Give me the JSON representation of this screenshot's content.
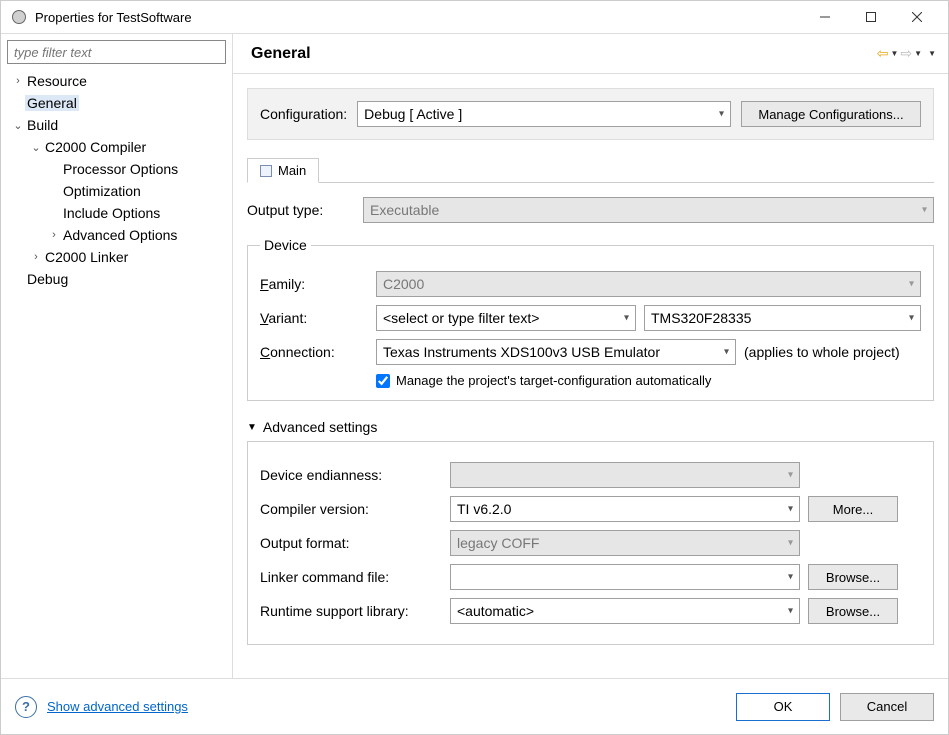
{
  "titlebar": {
    "title": "Properties for TestSoftware"
  },
  "sidebar": {
    "filter_placeholder": "type filter text",
    "items": [
      {
        "label": "Resource",
        "depth": 0,
        "twisty": "›"
      },
      {
        "label": "General",
        "depth": 0,
        "twisty": "",
        "selected": true
      },
      {
        "label": "Build",
        "depth": 0,
        "twisty": "⌄"
      },
      {
        "label": "C2000 Compiler",
        "depth": 1,
        "twisty": "⌄"
      },
      {
        "label": "Processor Options",
        "depth": 2,
        "twisty": ""
      },
      {
        "label": "Optimization",
        "depth": 2,
        "twisty": ""
      },
      {
        "label": "Include Options",
        "depth": 2,
        "twisty": ""
      },
      {
        "label": "Advanced Options",
        "depth": 2,
        "twisty": "›"
      },
      {
        "label": "C2000 Linker",
        "depth": 1,
        "twisty": "›"
      },
      {
        "label": "Debug",
        "depth": 0,
        "twisty": ""
      }
    ]
  },
  "page": {
    "heading": "General",
    "config_label": "Configuration:",
    "config_value": "Debug  [ Active ]",
    "manage_btn": "Manage Configurations...",
    "tab_main": "Main",
    "output_type_label": "Output type:",
    "output_type_value": "Executable",
    "device_legend": "Device",
    "family_label": "Family:",
    "family_value": "C2000",
    "variant_label": "Variant:",
    "variant_filter_value": "<select or type filter text>",
    "variant_value": "TMS320F28335",
    "connection_label": "Connection:",
    "connection_value": "Texas Instruments XDS100v3 USB Emulator",
    "connection_note": "(applies to whole project)",
    "manage_target_cfg": "Manage the project's target-configuration automatically",
    "adv_toggle": "Advanced settings",
    "endianness_label": "Device endianness:",
    "endianness_value": "",
    "compiler_label": "Compiler version:",
    "compiler_value": "TI v6.2.0",
    "more_btn": "More...",
    "output_format_label": "Output format:",
    "output_format_value": "legacy COFF",
    "linker_cmd_label": "Linker command file:",
    "linker_cmd_value": "",
    "runtime_lib_label": "Runtime support library:",
    "runtime_lib_value": "<automatic>",
    "browse_btn": "Browse..."
  },
  "footer": {
    "link": "Show advanced settings",
    "ok": "OK",
    "cancel": "Cancel"
  },
  "letters": {
    "F": "F",
    "amily": "amily:",
    "V": "V",
    "ariant": "ariant:",
    "C": "C",
    "onnection": "onnection:"
  }
}
